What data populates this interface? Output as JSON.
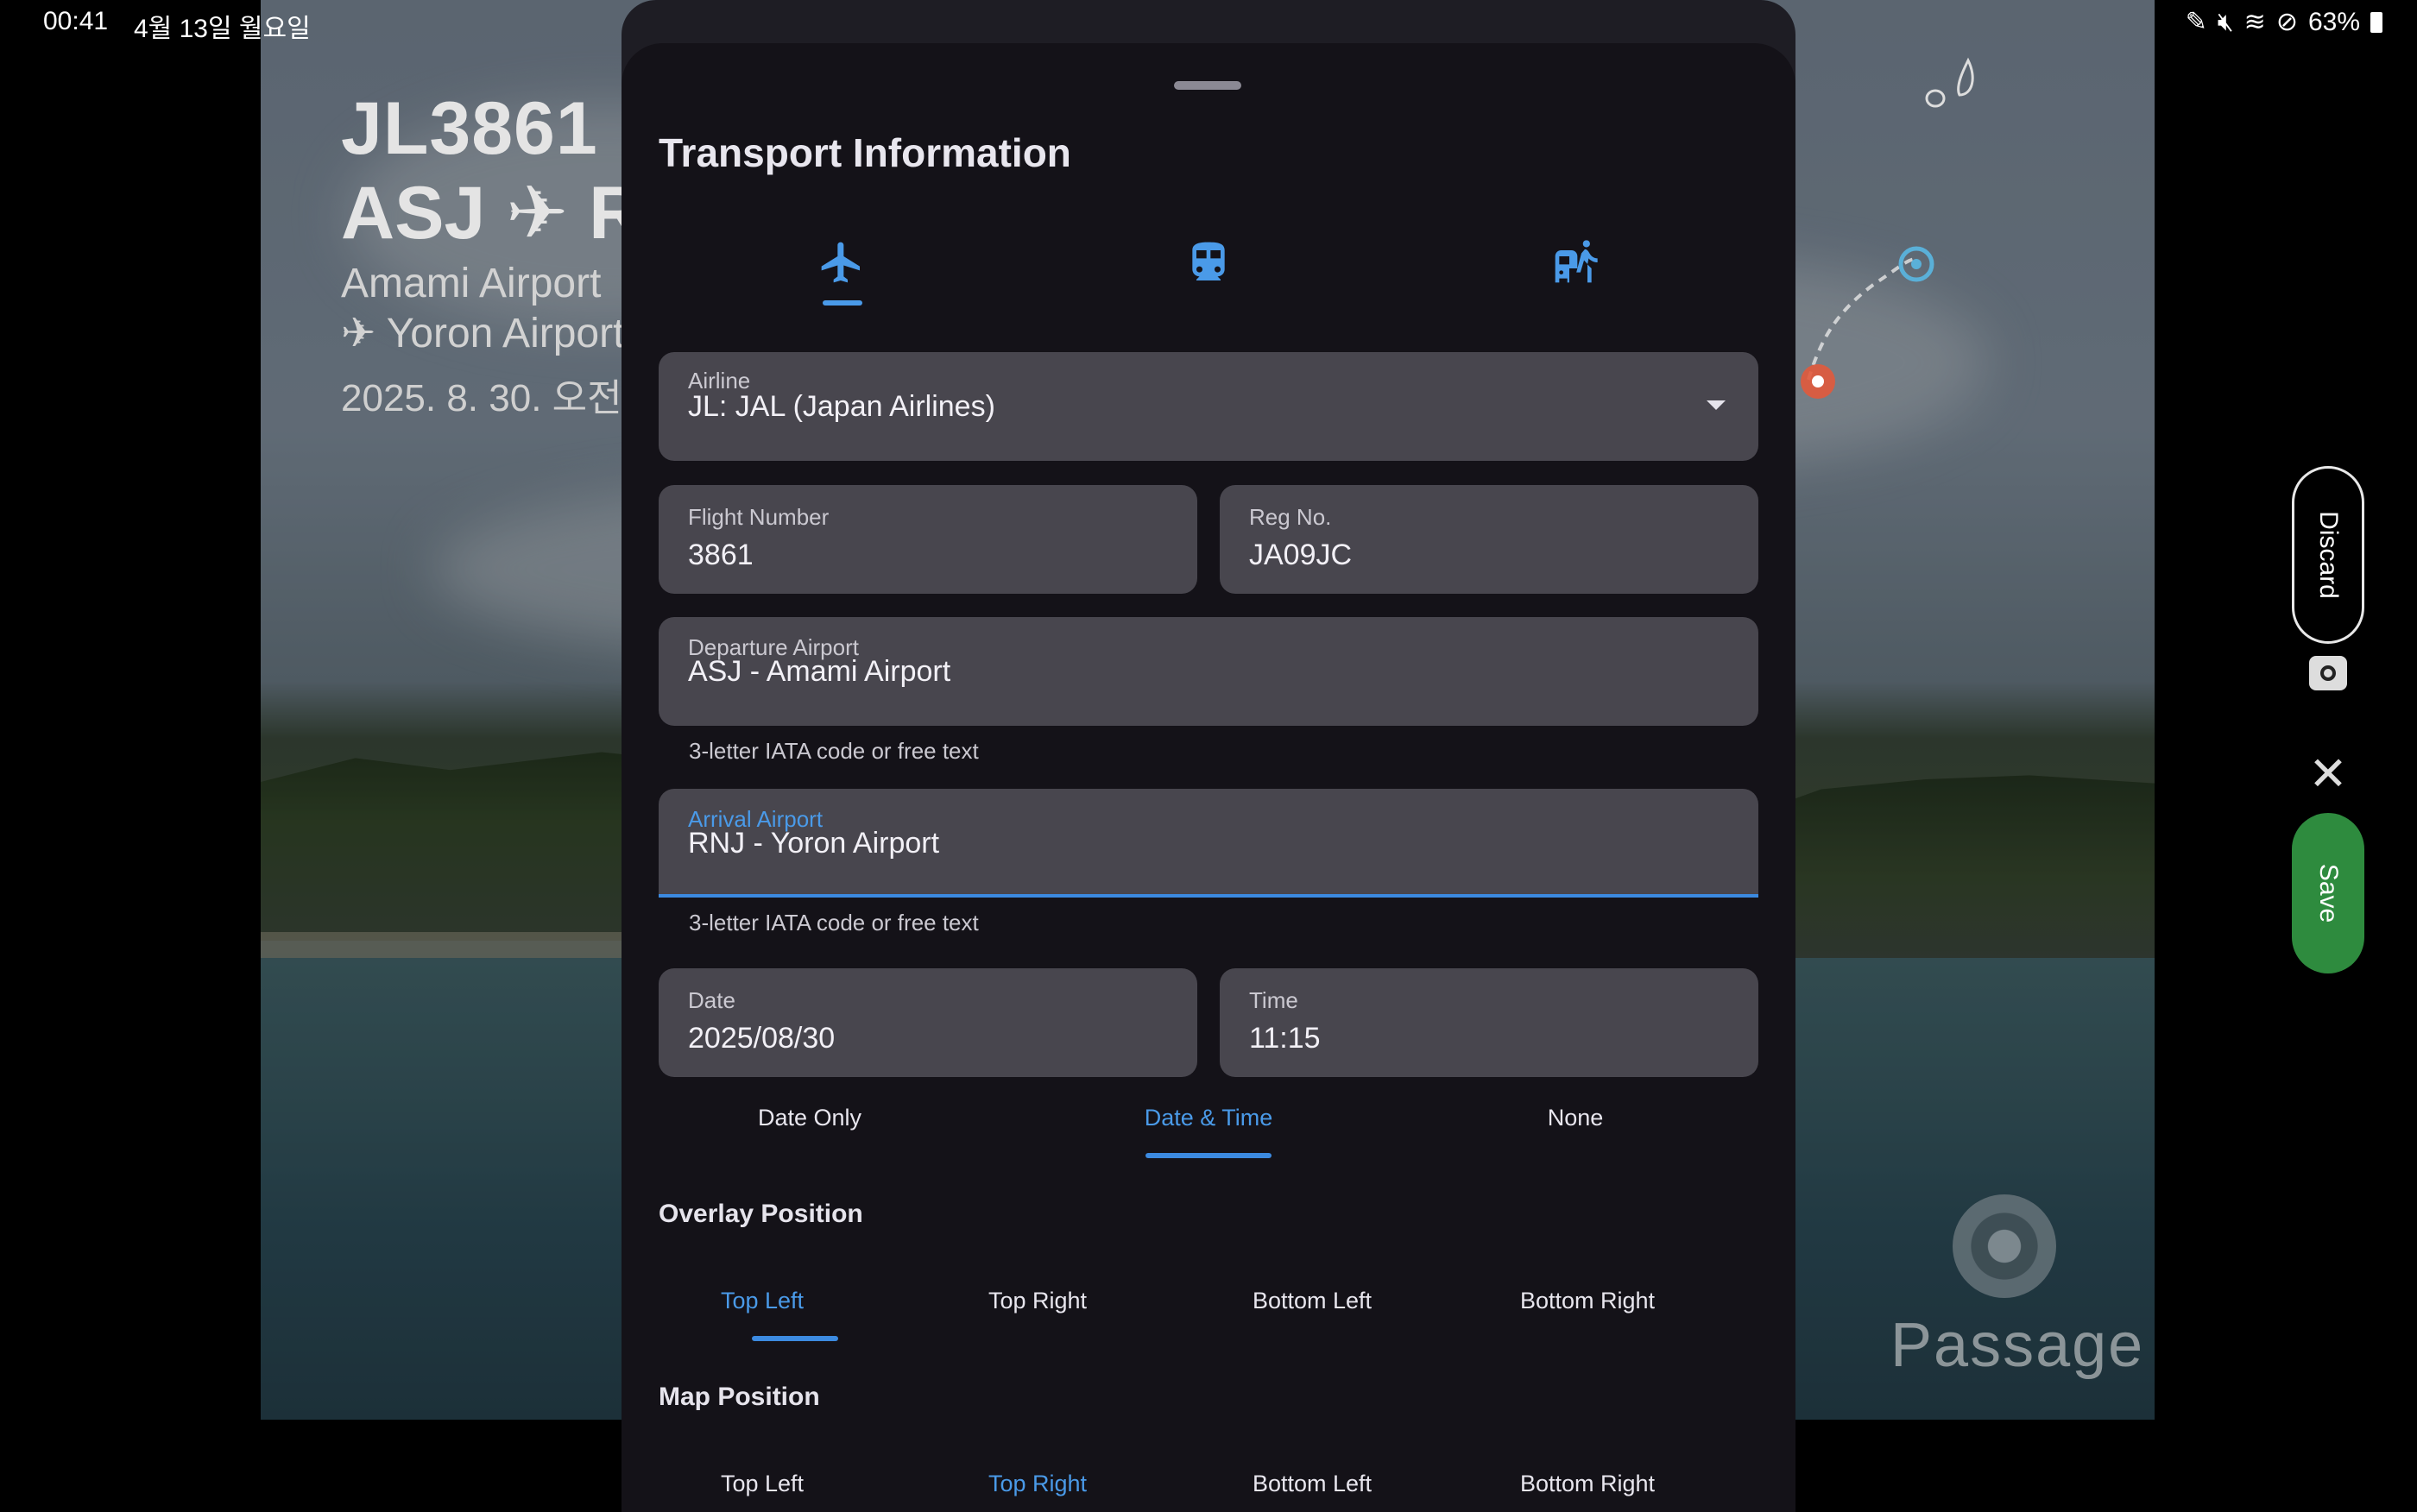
{
  "status_bar": {
    "time": "00:41",
    "date": "4월 13일 월요일",
    "battery": "63%"
  },
  "photo_overlay": {
    "title": "JL3861",
    "route": "ASJ ✈ R",
    "from": "Amami Airport",
    "to": "✈ Yoron Airport",
    "date": "2025. 8. 30. 오전"
  },
  "watermark": {
    "text": "Passage"
  },
  "side_actions": {
    "discard_label": "Discard",
    "save_label": "Save",
    "save_color": "#2e8b3e"
  },
  "sheet": {
    "title": "Transport Information",
    "modes": [
      "airplane-icon",
      "train-icon",
      "walk-icon"
    ],
    "active_mode": "airplane",
    "airline": {
      "label": "Airline",
      "value": "JL: JAL (Japan Airlines)"
    },
    "flight_number": {
      "label": "Flight Number",
      "value": "3861"
    },
    "reg_no": {
      "label": "Reg No.",
      "value": "JA09JC"
    },
    "departure": {
      "label": "Departure Airport",
      "value": "ASJ - Amami Airport",
      "helper": "3-letter IATA code or free text"
    },
    "arrival": {
      "label": "Arrival Airport",
      "value": "RNJ - Yoron Airport",
      "helper": "3-letter IATA code or free text"
    },
    "date": {
      "label": "Date",
      "value": "2025/08/30"
    },
    "time": {
      "label": "Time",
      "value": "11:15"
    },
    "datetime_mode": {
      "options": [
        "Date Only",
        "Date & Time",
        "None"
      ],
      "selected": "Date & Time"
    },
    "overlay_position": {
      "title": "Overlay Position",
      "options": [
        "Top Left",
        "Top Right",
        "Bottom Left",
        "Bottom Right"
      ],
      "selected": "Top Left"
    },
    "map_position": {
      "title": "Map Position",
      "options": [
        "Top Left",
        "Top Right",
        "Bottom Left",
        "Bottom Right"
      ],
      "selected": "Top Right"
    },
    "accent_color": "#4a9ae8"
  }
}
